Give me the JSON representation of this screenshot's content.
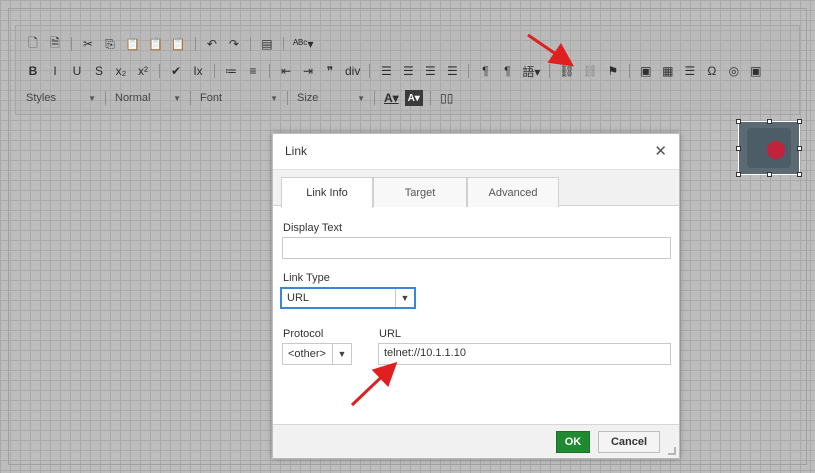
{
  "toolbar": {
    "row1": [
      {
        "name": "new-page-icon",
        "glyph": "🗋"
      },
      {
        "name": "template-icon",
        "glyph": "🗎"
      },
      {
        "name": "sep"
      },
      {
        "name": "cut-icon",
        "glyph": "✂"
      },
      {
        "name": "copy-icon",
        "glyph": "⎘"
      },
      {
        "name": "paste-icon",
        "glyph": "📋"
      },
      {
        "name": "paste-text-icon",
        "glyph": "📋"
      },
      {
        "name": "paste-word-icon",
        "glyph": "📋"
      },
      {
        "name": "sep"
      },
      {
        "name": "undo-icon",
        "glyph": "↶"
      },
      {
        "name": "redo-icon",
        "glyph": "↷"
      },
      {
        "name": "sep"
      },
      {
        "name": "find-icon",
        "glyph": "▤"
      },
      {
        "name": "sep"
      },
      {
        "name": "spellcheck-icon",
        "glyph": "ᴬᴮᶜ▾"
      }
    ],
    "row2": [
      {
        "name": "bold-icon",
        "glyph": "B",
        "bold": true
      },
      {
        "name": "italic-icon",
        "glyph": "I"
      },
      {
        "name": "underline-icon",
        "glyph": "U"
      },
      {
        "name": "strikethrough-icon",
        "glyph": "S"
      },
      {
        "name": "subscript-icon",
        "glyph": "x₂"
      },
      {
        "name": "superscript-icon",
        "glyph": "x²"
      },
      {
        "name": "sep"
      },
      {
        "name": "copy-formatting-icon",
        "glyph": "✔"
      },
      {
        "name": "remove-format-icon",
        "glyph": "Ix"
      },
      {
        "name": "sep"
      },
      {
        "name": "numbered-list-icon",
        "glyph": "≔"
      },
      {
        "name": "bulleted-list-icon",
        "glyph": "≡"
      },
      {
        "name": "sep"
      },
      {
        "name": "decrease-indent-icon",
        "glyph": "⇤"
      },
      {
        "name": "increase-indent-icon",
        "glyph": "⇥"
      },
      {
        "name": "blockquote-icon",
        "glyph": "❞"
      },
      {
        "name": "div-icon",
        "glyph": "div"
      },
      {
        "name": "sep"
      },
      {
        "name": "align-left-icon",
        "glyph": "☰"
      },
      {
        "name": "align-center-icon",
        "glyph": "☰"
      },
      {
        "name": "align-right-icon",
        "glyph": "☰"
      },
      {
        "name": "justify-icon",
        "glyph": "☰"
      },
      {
        "name": "sep"
      },
      {
        "name": "ltr-icon",
        "glyph": "¶"
      },
      {
        "name": "rtl-icon",
        "glyph": "¶"
      },
      {
        "name": "language-icon",
        "glyph": "語▾"
      },
      {
        "name": "sep"
      },
      {
        "name": "link-icon",
        "glyph": "⛓"
      },
      {
        "name": "unlink-icon",
        "glyph": "⛓",
        "dim": true
      },
      {
        "name": "anchor-icon",
        "glyph": "⚑"
      },
      {
        "name": "sep"
      },
      {
        "name": "image-icon",
        "glyph": "▣"
      },
      {
        "name": "table-icon",
        "glyph": "▦"
      },
      {
        "name": "horizontal-rule-icon",
        "glyph": "☰"
      },
      {
        "name": "special-char-icon",
        "glyph": "Ω"
      },
      {
        "name": "iframe-icon",
        "glyph": "◎"
      },
      {
        "name": "image2-icon",
        "glyph": "▣"
      }
    ],
    "row3": {
      "styles": "Styles",
      "format": "Normal",
      "font": "Font",
      "size": "Size",
      "text_color_glyph": "A▾",
      "bg_color_glyph": "A▾",
      "show_blocks_glyph": "▯▯"
    }
  },
  "dialog": {
    "title": "Link",
    "close_glyph": "✕",
    "tabs": {
      "link_info": "Link Info",
      "target": "Target",
      "advanced": "Advanced"
    },
    "display_text": {
      "label": "Display Text",
      "value": ""
    },
    "link_type": {
      "label": "Link Type",
      "value": "URL"
    },
    "protocol": {
      "label": "Protocol",
      "value": "<other>"
    },
    "url": {
      "label": "URL",
      "value": "telnet://10.1.1.10"
    },
    "buttons": {
      "ok": "OK",
      "cancel": "Cancel"
    }
  },
  "annotation_color": "#e02020",
  "colors": {
    "ok_button": "#1f8a2f",
    "focus_border": "#3b86d8",
    "lock": "#c3223c"
  }
}
